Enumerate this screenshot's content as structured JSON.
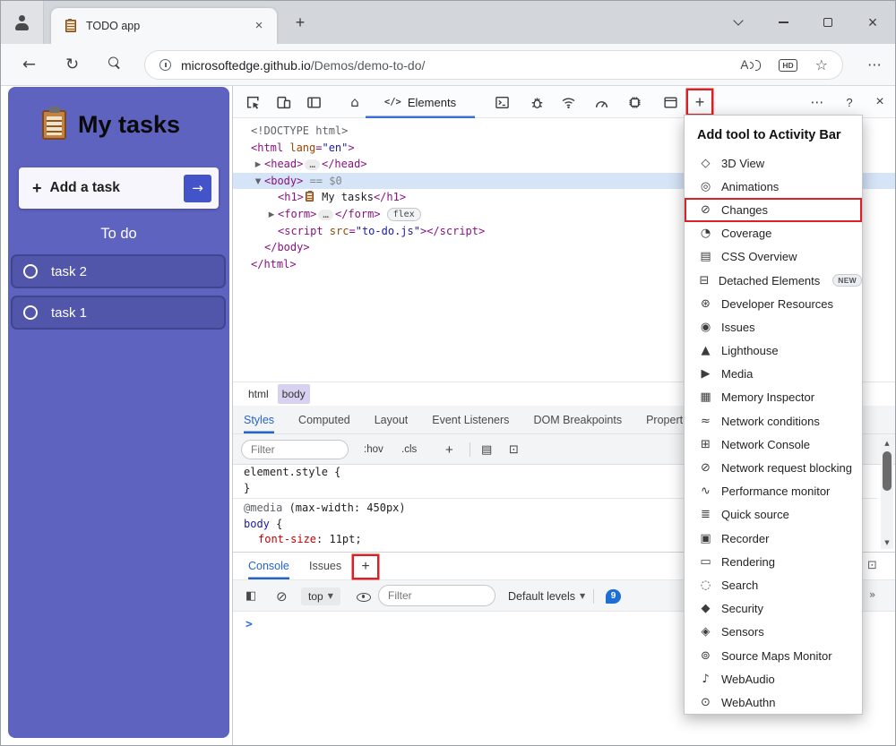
{
  "window": {
    "tab_title": "TODO app",
    "new_tab": "+",
    "tab_close": "×",
    "close": "×"
  },
  "browser": {
    "url_domain": "microsoftedge.github.io",
    "url_path": "/Demos/demo-to-do/",
    "hd_badge": "HD",
    "read_aloud": "A"
  },
  "icons": {
    "back": "←",
    "refresh": "↻",
    "star": "☆",
    "more": "⋯",
    "home": "⌂",
    "plus": "+",
    "help": "?",
    "close": "×",
    "console_sidebar": "◧",
    "clear_console": "⊘",
    "caret_down": "▼",
    "styles_icon1": "▤",
    "styles_icon2": "⊡",
    "drawer_peek1": "⊡",
    "drawer_peek2": "»",
    "scroll_up": "▲",
    "scroll_down": "▼",
    "arrow_submit": "→"
  },
  "app": {
    "title": "My tasks",
    "add_plus": "+",
    "add_label": "Add a task",
    "todo_heading": "To do",
    "tasks": [
      {
        "label": "task 2"
      },
      {
        "label": "task 1"
      }
    ]
  },
  "devtools": {
    "toolbar": {
      "elements_icon": "</>",
      "elements_label": "Elements",
      "plus": "+",
      "more": "⋯",
      "help": "?",
      "close": "×",
      "home": "⌂"
    },
    "dom_tree": {
      "lines": [
        {
          "indent": 0,
          "tokens": [
            {
              "c": "doctype",
              "t": "<!DOCTYPE html>"
            }
          ]
        },
        {
          "indent": 0,
          "tokens": [
            {
              "c": "tag",
              "t": "<html"
            },
            {
              "c": "attr",
              "t": " lang"
            },
            {
              "c": "tag",
              "t": "="
            },
            {
              "c": "val",
              "t": "\"en\""
            },
            {
              "c": "tag",
              "t": ">"
            }
          ]
        },
        {
          "indent": 1,
          "arrow": "▶",
          "tokens": [
            {
              "c": "tag",
              "t": "<head>"
            },
            {
              "c": "ell",
              "t": "…"
            },
            {
              "c": "tag",
              "t": "</head>"
            }
          ]
        },
        {
          "indent": 1,
          "arrow": "▼",
          "selected": true,
          "tokens": [
            {
              "c": "tag",
              "t": "<body>"
            },
            {
              "c": "meta",
              "t": " == $0"
            }
          ]
        },
        {
          "indent": 2,
          "tokens": [
            {
              "c": "tag",
              "t": "<h1>"
            },
            {
              "c": "icon",
              "t": "clipboard"
            },
            {
              "c": "text",
              "t": " My tasks"
            },
            {
              "c": "tag",
              "t": "</h1>"
            }
          ]
        },
        {
          "indent": 2,
          "arrow": "▶",
          "tokens": [
            {
              "c": "tag",
              "t": "<form>"
            },
            {
              "c": "ell",
              "t": "…"
            },
            {
              "c": "tag",
              "t": "</form>"
            },
            {
              "c": "flex",
              "t": "flex"
            }
          ]
        },
        {
          "indent": 2,
          "tokens": [
            {
              "c": "tag",
              "t": "<script"
            },
            {
              "c": "attr",
              "t": " src"
            },
            {
              "c": "tag",
              "t": "="
            },
            {
              "c": "val",
              "t": "\"to-do.js\""
            },
            {
              "c": "tag",
              "t": ">"
            },
            {
              "c": "tag",
              "t": "</script>"
            }
          ]
        },
        {
          "indent": 1,
          "tokens": [
            {
              "c": "tag",
              "t": "</body>"
            }
          ]
        },
        {
          "indent": 0,
          "tokens": [
            {
              "c": "tag",
              "t": "</html>"
            }
          ]
        }
      ]
    },
    "breadcrumbs": [
      "html",
      "body"
    ],
    "styles_tabs": [
      "Styles",
      "Computed",
      "Layout",
      "Event Listeners",
      "DOM Breakpoints",
      "Properties"
    ],
    "styles_toolbar": {
      "filter_placeholder": "Filter",
      "hov": ":hov",
      "cls": ".cls",
      "plus": "+"
    },
    "styles_pane": {
      "element_style": "element.style",
      "brace_open": " {",
      "brace_close": "}",
      "media_at": "@media",
      "media_condition": " (max-width: 450px)",
      "selector": "body",
      "selector_brace": " {",
      "property": "font-size",
      "separator": ": ",
      "value": "11pt;"
    },
    "console": {
      "tabs": [
        "Console",
        "Issues"
      ],
      "plus": "+",
      "context_label": "top",
      "filter_placeholder": "Filter",
      "levels_label": "Default levels",
      "message_count": "9",
      "prompt": ">"
    }
  },
  "menu": {
    "title": "Add tool to Activity Bar",
    "items": [
      {
        "icon": "cube-icon",
        "glyph": "◇",
        "label": "3D View"
      },
      {
        "icon": "animations-icon",
        "glyph": "◎",
        "label": "Animations"
      },
      {
        "icon": "changes-icon",
        "glyph": "⊘",
        "label": "Changes",
        "highlighted": true
      },
      {
        "icon": "coverage-icon",
        "glyph": "◔",
        "label": "Coverage"
      },
      {
        "icon": "css-overview-icon",
        "glyph": "▤",
        "label": "CSS Overview"
      },
      {
        "icon": "detached-elements-icon",
        "glyph": "⊟",
        "label": "Detached Elements",
        "badge": "NEW"
      },
      {
        "icon": "developer-resources-icon",
        "glyph": "⊛",
        "label": "Developer Resources"
      },
      {
        "icon": "issues-icon",
        "glyph": "◉",
        "label": "Issues"
      },
      {
        "icon": "lighthouse-icon",
        "glyph": "▲",
        "label": "Lighthouse"
      },
      {
        "icon": "media-icon",
        "glyph": "▶",
        "label": "Media"
      },
      {
        "icon": "memory-inspector-icon",
        "glyph": "▦",
        "label": "Memory Inspector"
      },
      {
        "icon": "network-conditions-icon",
        "glyph": "≈",
        "label": "Network conditions"
      },
      {
        "icon": "network-console-icon",
        "glyph": "⊞",
        "label": "Network Console"
      },
      {
        "icon": "network-request-blocking-icon",
        "glyph": "⊘",
        "label": "Network request blocking"
      },
      {
        "icon": "performance-monitor-icon",
        "glyph": "∿",
        "label": "Performance monitor"
      },
      {
        "icon": "quick-source-icon",
        "glyph": "≣",
        "label": "Quick source"
      },
      {
        "icon": "recorder-icon",
        "glyph": "▣",
        "label": "Recorder"
      },
      {
        "icon": "rendering-icon",
        "glyph": "▭",
        "label": "Rendering"
      },
      {
        "icon": "search-icon",
        "glyph": "◌",
        "label": "Search"
      },
      {
        "icon": "security-icon",
        "glyph": "◆",
        "label": "Security"
      },
      {
        "icon": "sensors-icon",
        "glyph": "◈",
        "label": "Sensors"
      },
      {
        "icon": "source-maps-monitor-icon",
        "glyph": "⊚",
        "label": "Source Maps Monitor"
      },
      {
        "icon": "webaudio-icon",
        "glyph": "♪",
        "label": "WebAudio"
      },
      {
        "icon": "webauthn-icon",
        "glyph": "⊙",
        "label": "WebAuthn"
      }
    ]
  },
  "colors": {
    "app_background": "#5f63c0",
    "task_background": "#5156ab",
    "task_border": "#404590",
    "add_button_blue": "#4353c8",
    "highlight_red": "#dd2025",
    "accent_blue": "#2563c9",
    "selected_node_background": "#d5e4f7",
    "breadcrumb_active_background": "#d8d2f0",
    "tag_color": "#881280",
    "attribute_color": "#994500",
    "value_color": "#1a1aa6",
    "property_color": "#c80000"
  }
}
